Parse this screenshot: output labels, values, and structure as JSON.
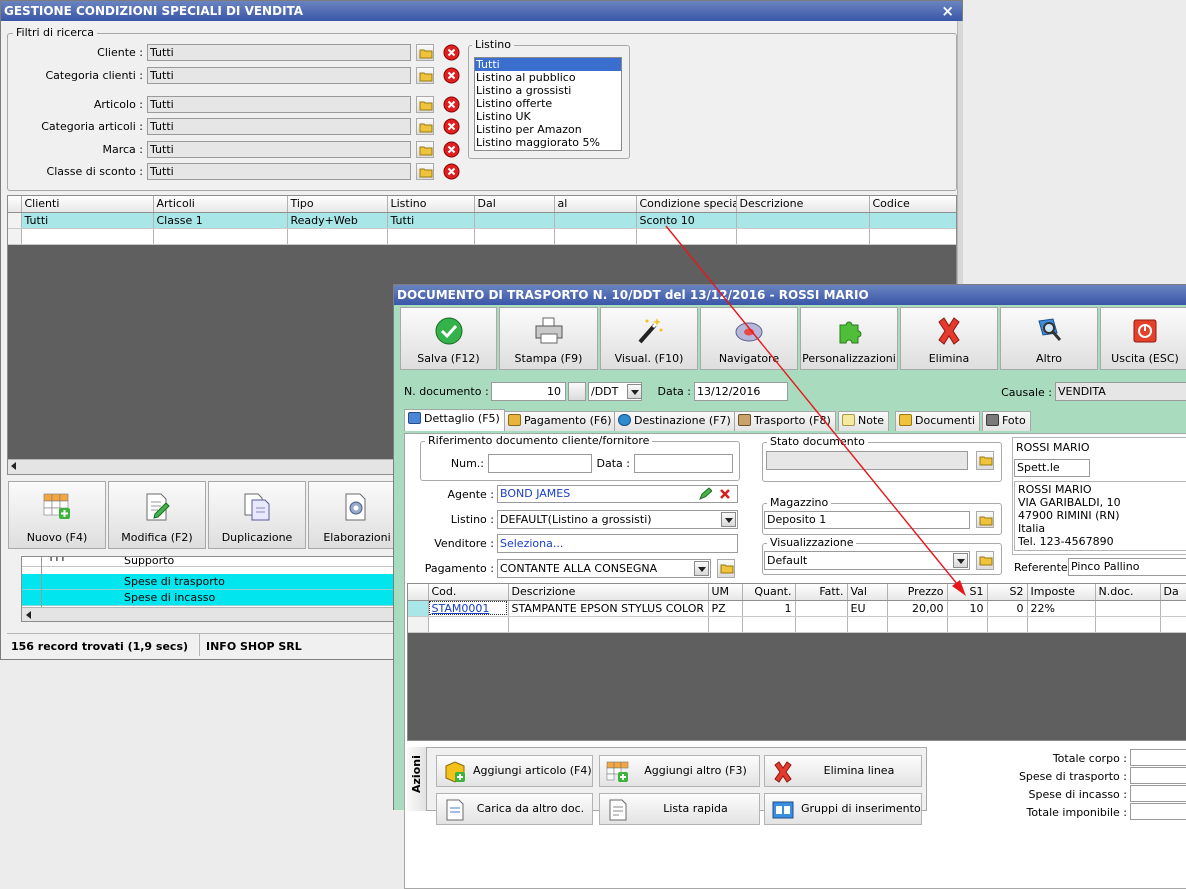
{
  "win1": {
    "title": "GESTIONE CONDIZIONI SPECIALI DI VENDITA",
    "close_glyph": "×",
    "filters_legend": "Filtri di ricerca",
    "filters": [
      {
        "label": "Cliente :",
        "value": "Tutti"
      },
      {
        "label": "Categoria clienti :",
        "value": "Tutti"
      },
      {
        "label": "Articolo :",
        "value": "Tutti"
      },
      {
        "label": "Categoria articoli :",
        "value": "Tutti"
      },
      {
        "label": "Marca :",
        "value": "Tutti"
      },
      {
        "label": "Classe di sconto :",
        "value": "Tutti"
      }
    ],
    "listino_legend": "Listino",
    "listino_options": [
      "Tutti",
      "Listino al pubblico",
      "Listino a grossisti",
      "Listino offerte",
      "Listino UK",
      "Listino per Amazon",
      "Listino maggiorato 5%"
    ],
    "listino_selected": 0,
    "grid_headers": [
      "",
      "Clienti",
      "Articoli",
      "Tipo",
      "Listino",
      "Dal",
      "al",
      "Condizione speciale",
      "Descrizione",
      "Codice"
    ],
    "grid_rows": [
      [
        "",
        "Tutti",
        "Classe 1",
        "Ready+Web",
        "Tutti",
        "",
        "",
        "Sconto 10",
        "",
        ""
      ]
    ],
    "buttons": {
      "new": "Nuovo (F4)",
      "edit": "Modifica (F2)",
      "dup": "Duplicazione",
      "proc": "Elaborazioni"
    },
    "lower_rows": [
      {
        "c1": "TTT",
        "c2": "Supporto"
      },
      {
        "c1": "",
        "c2": "Spese di trasporto"
      },
      {
        "c1": "",
        "c2": "Spese di incasso"
      }
    ],
    "status_records": "156 record trovati (1,9 secs)",
    "status_company": "INFO SHOP SRL"
  },
  "win2": {
    "title": "DOCUMENTO DI TRASPORTO N. 10/DDT del 13/12/2016 - ROSSI MARIO",
    "toolbar": [
      "Salva (F12)",
      "Stampa (F9)",
      "Visual. (F10)",
      "Navigatore",
      "Personalizzazioni",
      "Elimina",
      "Altro",
      "Uscita (ESC)"
    ],
    "ndoc_label": "N. documento :",
    "ndoc_value": "10",
    "ndoc_series": "/DDT",
    "data_label": "Data :",
    "data_value": "13/12/2016",
    "causale_label": "Causale :",
    "causale_value": "VENDITA",
    "tabs": [
      "Dettaglio (F5)",
      "Pagamento (F6)",
      "Destinazione (F7)",
      "Trasporto (F8)",
      "Note",
      "Documenti",
      "Foto"
    ],
    "rif_legend": "Riferimento documento cliente/fornitore",
    "num_label": "Num.:",
    "rif_data_label": "Data :",
    "agente_label": "Agente :",
    "agente_value": "BOND JAMES",
    "listino_label": "Listino :",
    "listino_value": "DEFAULT(Listino a grossisti)",
    "venditore_label": "Venditore :",
    "venditore_value": "Seleziona...",
    "pagamento_label": "Pagamento :",
    "pagamento_value": "CONTANTE ALLA CONSEGNA",
    "stato_legend": "Stato documento",
    "magazzino_legend": "Magazzino",
    "magazzino_value": "Deposito 1",
    "visual_legend": "Visualizzazione",
    "visual_value": "Default",
    "customer_name": "ROSSI MARIO",
    "customer_title": "Spett.le",
    "address_lines": [
      "ROSSI MARIO",
      "VIA GARIBALDI, 10",
      "47900 RIMINI (RN)",
      "Italia",
      "Tel. 123-4567890"
    ],
    "referente_label": "Referente",
    "referente_value": "Pinco Pallino",
    "grid_headers": [
      "",
      "Cod.",
      "Descrizione",
      "UM",
      "Quant.",
      "Fatt.",
      "Val",
      "Prezzo",
      "S1",
      "S2",
      "Imposte",
      "N.doc.",
      "Da"
    ],
    "grid_rows": [
      [
        "",
        "STAM0001",
        "STAMPANTE EPSON STYLUS COLOR C...",
        "PZ",
        "1",
        "",
        "EU",
        "20,00",
        "10",
        "0",
        "22%",
        "",
        ""
      ]
    ],
    "azioni_label": "Azioni",
    "actions": [
      "Aggiungi articolo (F4)",
      "Aggiungi altro (F3)",
      "Elimina linea",
      "Carica da altro doc.",
      "Lista rapida",
      "Gruppi di inserimento"
    ],
    "totals": [
      "Totale corpo :",
      "Spese di trasporto :",
      "Spese di incasso :",
      "Totale imponibile :"
    ]
  },
  "colors": {
    "title_blue": "#3a56a8",
    "green_bg": "#a9dcbf",
    "cyan_row": "#a8e6e8",
    "cyan_lower": "#00e5ee",
    "link_blue": "#1a3fc4",
    "arrow_red": "#e8161a"
  }
}
